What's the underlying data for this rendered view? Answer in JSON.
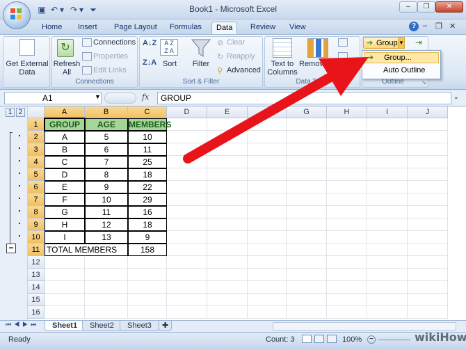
{
  "window": {
    "title": "Book1 - Microsoft Excel"
  },
  "tabs": [
    "Home",
    "Insert",
    "Page Layout",
    "Formulas",
    "Data",
    "Review",
    "View"
  ],
  "ribbon": {
    "get_external": "Get External Data",
    "refresh": "Refresh All",
    "connections": "Connections",
    "properties": "Properties",
    "edit_links": "Edit Links",
    "connections_group": "Connections",
    "sort": "Sort",
    "filter": "Filter",
    "clear": "Clear",
    "reapply": "Reapply",
    "advanced": "Advanced",
    "sort_group": "Sort & Filter",
    "text_to_columns": "Text to Columns",
    "remove_dup": "Remove Duplicates",
    "data_tools_group": "Data Tools",
    "group": "Group",
    "outline_group": "Outline"
  },
  "dropdown": {
    "group": "Group...",
    "auto_outline": "Auto Outline"
  },
  "formula_bar": {
    "name_box": "A1",
    "fx": "fx",
    "formula": "GROUP"
  },
  "columns": [
    "A",
    "B",
    "C",
    "D",
    "E",
    "F",
    "G",
    "H",
    "I",
    "J"
  ],
  "rows": [
    "1",
    "2",
    "3",
    "4",
    "5",
    "6",
    "7",
    "8",
    "9",
    "10",
    "11",
    "12",
    "13",
    "14",
    "15",
    "16"
  ],
  "outline_levels": [
    "1",
    "2"
  ],
  "table": {
    "headers": [
      "GROUP",
      "AGE",
      "MEMBERS"
    ],
    "data": [
      [
        "A",
        "5",
        "10"
      ],
      [
        "B",
        "6",
        "11"
      ],
      [
        "C",
        "7",
        "25"
      ],
      [
        "D",
        "8",
        "18"
      ],
      [
        "E",
        "9",
        "22"
      ],
      [
        "F",
        "10",
        "29"
      ],
      [
        "G",
        "11",
        "16"
      ],
      [
        "H",
        "12",
        "18"
      ],
      [
        "I",
        "13",
        "9"
      ]
    ],
    "total_label": "TOTAL MEMBERS",
    "total_value": "158"
  },
  "sheets": [
    "Sheet1",
    "Sheet2",
    "Sheet3"
  ],
  "status": {
    "ready": "Ready",
    "count": "Count: 3",
    "zoom": "100%"
  },
  "watermark": "wikiHow",
  "colors": {
    "header_green": "#a6d59a",
    "arrow_red": "#e8141a",
    "selected_header": "#f1c15f"
  }
}
